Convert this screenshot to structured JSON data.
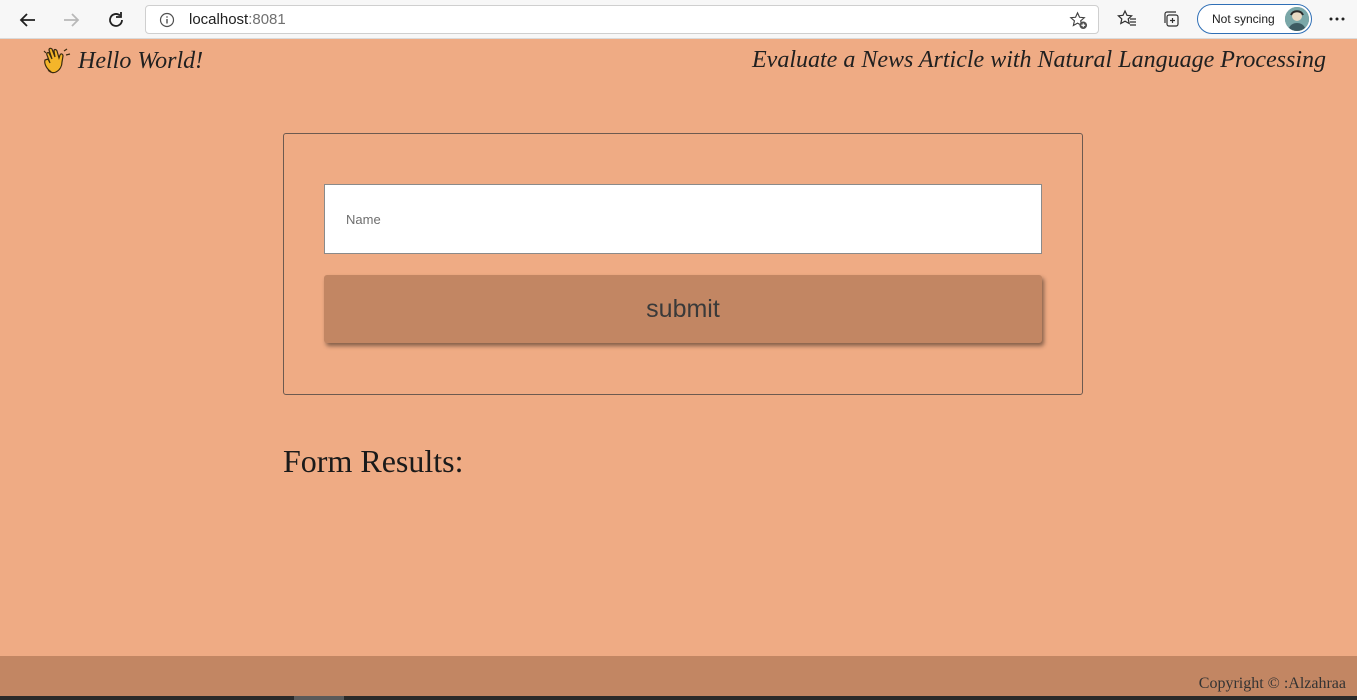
{
  "browser": {
    "url_host": "localhost",
    "url_port": ":8081",
    "sync_label": "Not syncing",
    "icons": [
      "back-arrow-icon",
      "forward-arrow-icon",
      "reload-icon",
      "info-icon",
      "favorite-add-icon",
      "favorites-icon",
      "collections-icon",
      "profile-avatar-icon",
      "more-options-icon"
    ]
  },
  "header": {
    "greeting": "Hello World!",
    "greeting_icon": "waving-hand-icon",
    "headline": "Evaluate a News Article with Natural Language Processing"
  },
  "form": {
    "name_placeholder": "Name",
    "name_value": "",
    "submit_label": "submit"
  },
  "results": {
    "title": "Form Results:"
  },
  "footer": {
    "copyright": "Copyright © :Alzahraa"
  },
  "colors": {
    "page_background": "#efab84",
    "button_and_footer": "#c28663",
    "chrome_background": "#f7f7f7",
    "sync_border": "#2f6fb6"
  }
}
